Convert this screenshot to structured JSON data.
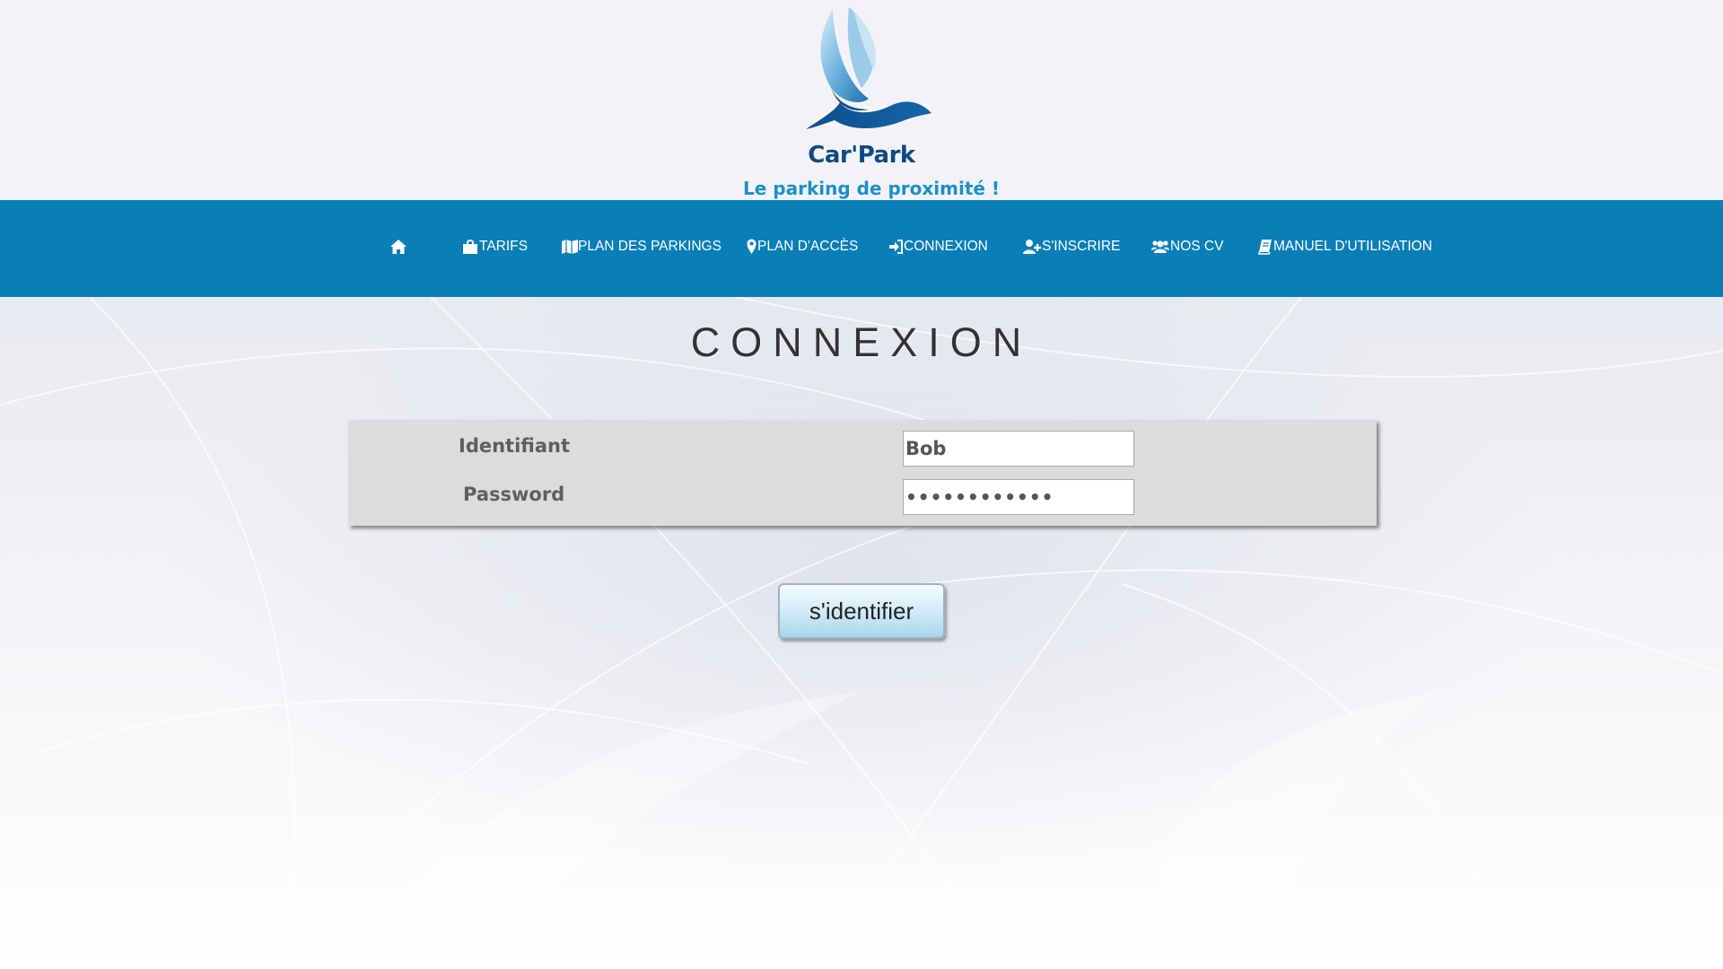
{
  "brand": {
    "name": "Car'Park",
    "tagline": "Le parking de proximité !",
    "primary_color": "#0a7eb6",
    "logo_color": "#10497f",
    "tagline_color": "#1c8fc8"
  },
  "nav": {
    "items": [
      {
        "label": "",
        "icon": "home-icon"
      },
      {
        "label": "TARIFS",
        "icon": "shopping-bag-icon"
      },
      {
        "label": "PLAN DES PARKINGS",
        "icon": "map-icon"
      },
      {
        "label": "PLAN D'ACCÈS",
        "icon": "map-marker-icon"
      },
      {
        "label": "CONNEXION",
        "icon": "sign-in-icon"
      },
      {
        "label": "S'INSCRIRE",
        "icon": "user-plus-icon"
      },
      {
        "label": "NOS CV",
        "icon": "users-icon"
      },
      {
        "label": "MANUEL D'UTILISATION",
        "icon": "book-icon"
      }
    ]
  },
  "page": {
    "title": "CONNEXION"
  },
  "form": {
    "username_label": "Identifiant",
    "username_value": "Bob",
    "password_label": "Password",
    "password_value": "••••••••••••",
    "submit_label": "s'identifier"
  }
}
